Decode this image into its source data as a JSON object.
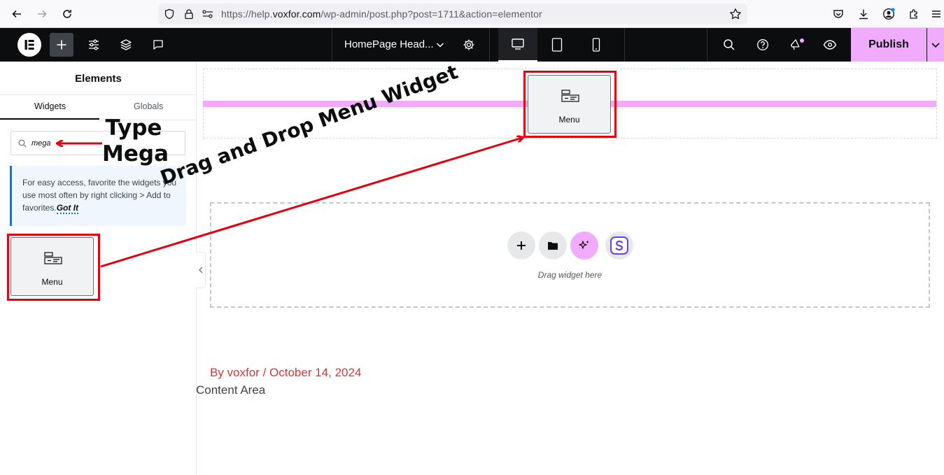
{
  "browser": {
    "url_prefix": "https://help.",
    "url_host": "voxfor.com",
    "url_path": "/wp-admin/post.php?post=1711&action=elementor"
  },
  "editor": {
    "document_title": "HomePage Head...",
    "publish_label": "Publish",
    "accent_color": "#f0abfc"
  },
  "panel": {
    "title": "Elements",
    "tabs": [
      {
        "label": "Widgets",
        "active": true
      },
      {
        "label": "Globals",
        "active": false
      }
    ],
    "search": {
      "value": "mega"
    },
    "notice": {
      "text": "For easy access, favorite the widgets you use most often by right clicking > Add to favorites.",
      "link": "Got It"
    },
    "widgets": [
      {
        "label": "Menu",
        "icon": "mega-menu-icon"
      }
    ]
  },
  "canvas": {
    "dragged_widget": {
      "label": "Menu",
      "icon": "mega-menu-icon"
    },
    "drop_zone_text": "Drag widget here",
    "post_meta": "By voxfor / October 14, 2024",
    "content_area": "Content Area"
  },
  "annotations": {
    "type_line1": "Type",
    "type_line2": "Mega",
    "drag_text": "Drag and Drop Menu Widget",
    "color": "#e3000f"
  }
}
